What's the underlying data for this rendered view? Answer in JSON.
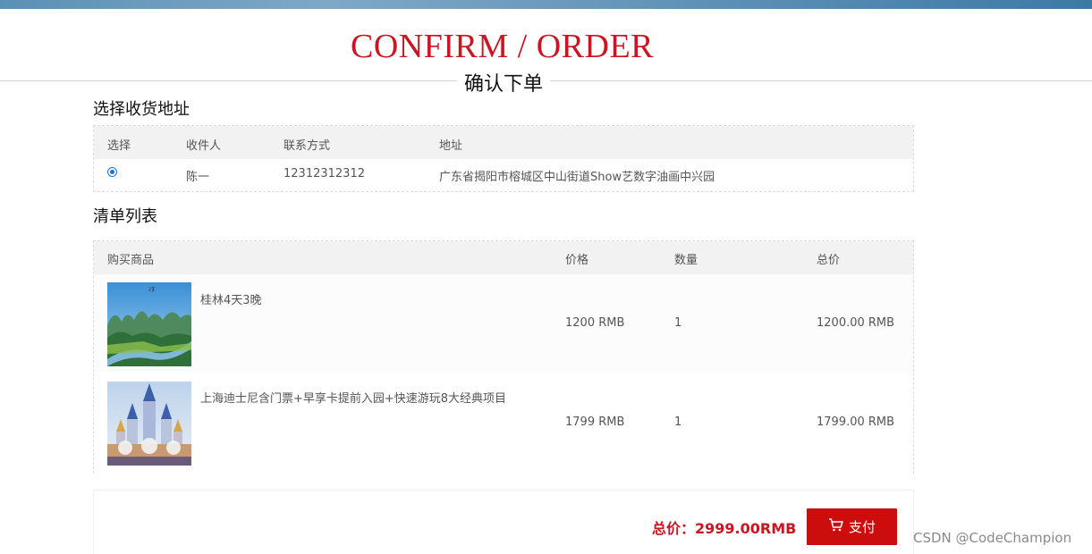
{
  "header": {
    "title": "CONFIRM / ORDER",
    "subtitle": "确认下单"
  },
  "address": {
    "section_title": "选择收货地址",
    "columns": [
      "选择",
      "收件人",
      "联系方式",
      "地址"
    ],
    "rows": [
      {
        "selected": true,
        "recipient": "陈一",
        "phone": "12312312312",
        "address": "广东省揭阳市榕城区中山街道Show艺数字油画中兴园"
      }
    ]
  },
  "list": {
    "section_title": "清单列表",
    "columns": [
      "购买商品",
      "价格",
      "数量",
      "总价"
    ],
    "items": [
      {
        "name": "桂林4天3晚",
        "price": "1200 RMB",
        "qty": "1",
        "subtotal": "1200.00 RMB",
        "thumb": "guilin-landscape"
      },
      {
        "name": "上海迪士尼含门票+早享卡提前入园+快速游玩8大经典项目",
        "price": "1799 RMB",
        "qty": "1",
        "subtotal": "1799.00 RMB",
        "thumb": "disney-castle"
      }
    ]
  },
  "footer": {
    "total_label": "总价：2999.00RMB",
    "pay_label": "支付",
    "pay_icon": "cart-icon"
  },
  "watermark": "CSDN @CodeChampion",
  "colors": {
    "accent": "#c81623",
    "pay_button": "#cc0d0d",
    "radio": "#1a73e8"
  }
}
